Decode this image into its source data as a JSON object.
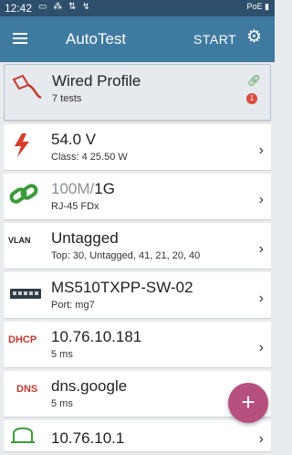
{
  "status_bar": {
    "time": "12:42",
    "right": "PoE"
  },
  "app_bar": {
    "title": "AutoTest",
    "start_label": "START"
  },
  "cards": [
    {
      "title": "Wired Profile",
      "sub": "7 tests",
      "badge": "1"
    },
    {
      "title": "54.0 V",
      "sub": "Class: 4   25.50 W"
    },
    {
      "title_dim": "100M/",
      "title": "1G",
      "sub": "RJ-45   FDx"
    },
    {
      "tag": "VLAN",
      "title": "Untagged",
      "sub": "Top: 30, Untagged, 41, 21, 20, 40"
    },
    {
      "title": "MS510TXPP-SW-02",
      "sub": "Port: mg7"
    },
    {
      "tag": "DHCP",
      "title": "10.76.10.181",
      "sub": "5 ms"
    },
    {
      "tag": "DNS",
      "title": "dns.google",
      "sub": "5 ms"
    },
    {
      "title": "10.76.10.1"
    }
  ],
  "fab": {
    "label": "+"
  }
}
